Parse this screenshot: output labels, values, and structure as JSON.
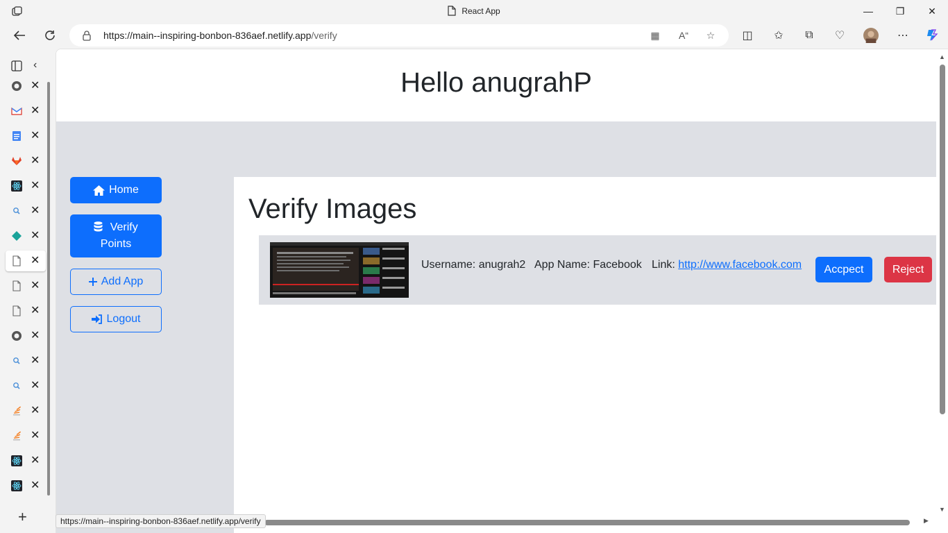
{
  "window": {
    "title": "React App"
  },
  "address_bar": {
    "url_host": "https://main--inspiring-bonbon-836aef.netlify.app",
    "url_path": "/verify"
  },
  "tabs": [
    {
      "icon": "github-icon"
    },
    {
      "icon": "gmail-icon"
    },
    {
      "icon": "docs-icon"
    },
    {
      "icon": "gitlab-icon"
    },
    {
      "icon": "react-icon"
    },
    {
      "icon": "search-icon"
    },
    {
      "icon": "diamond-icon"
    },
    {
      "icon": "page-icon",
      "active": true
    },
    {
      "icon": "page-icon"
    },
    {
      "icon": "page-icon"
    },
    {
      "icon": "github-icon"
    },
    {
      "icon": "search-icon"
    },
    {
      "icon": "search-icon"
    },
    {
      "icon": "stackoverflow-icon"
    },
    {
      "icon": "stackoverflow-icon"
    },
    {
      "icon": "react-icon"
    },
    {
      "icon": "react-icon"
    }
  ],
  "page": {
    "greeting": "Hello anugrahP",
    "sidebar": {
      "home": "Home",
      "verify_points": "Verify Points",
      "add_app": "Add App",
      "logout": "Logout"
    },
    "heading": "Verify Images",
    "item": {
      "username_label": "Username: anugrah2",
      "app_name_label": "App Name: Facebook",
      "link_label": "Link: ",
      "link_url": "http://www.facebook.com",
      "accept_button": "Accpect",
      "reject_button": "Reject"
    }
  },
  "status_url": "https://main--inspiring-bonbon-836aef.netlify.app/verify",
  "colors": {
    "primary": "#0d6efd",
    "danger": "#dc3545",
    "panel_gray": "#dee0e5"
  }
}
